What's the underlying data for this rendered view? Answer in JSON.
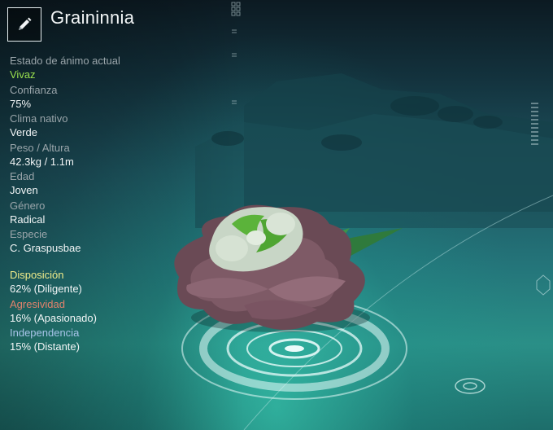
{
  "creature": {
    "name": "Graininnia"
  },
  "icons": {
    "edit": "pencil-icon"
  },
  "stats": [
    {
      "label": "Estado de ánimo actual",
      "value": "Vivaz"
    },
    {
      "label": "Confianza",
      "value": "75%"
    },
    {
      "label": "Clima nativo",
      "value": "Verde"
    },
    {
      "label": "Peso / Altura",
      "value": "42.3kg / 1.1m"
    },
    {
      "label": "Edad",
      "value": "Joven"
    },
    {
      "label": "Género",
      "value": "Radical"
    },
    {
      "label": "Especie",
      "value": "C. Graspusbae"
    }
  ],
  "traits": [
    {
      "label": "Disposición",
      "value": "62% (Diligente)",
      "color": "#f0ec8a"
    },
    {
      "label": "Agresividad",
      "value": "16% (Apasionado)",
      "color": "#e2826c"
    },
    {
      "label": "Independencia",
      "value": "15% (Distante)",
      "color": "#a7c4e9"
    }
  ]
}
